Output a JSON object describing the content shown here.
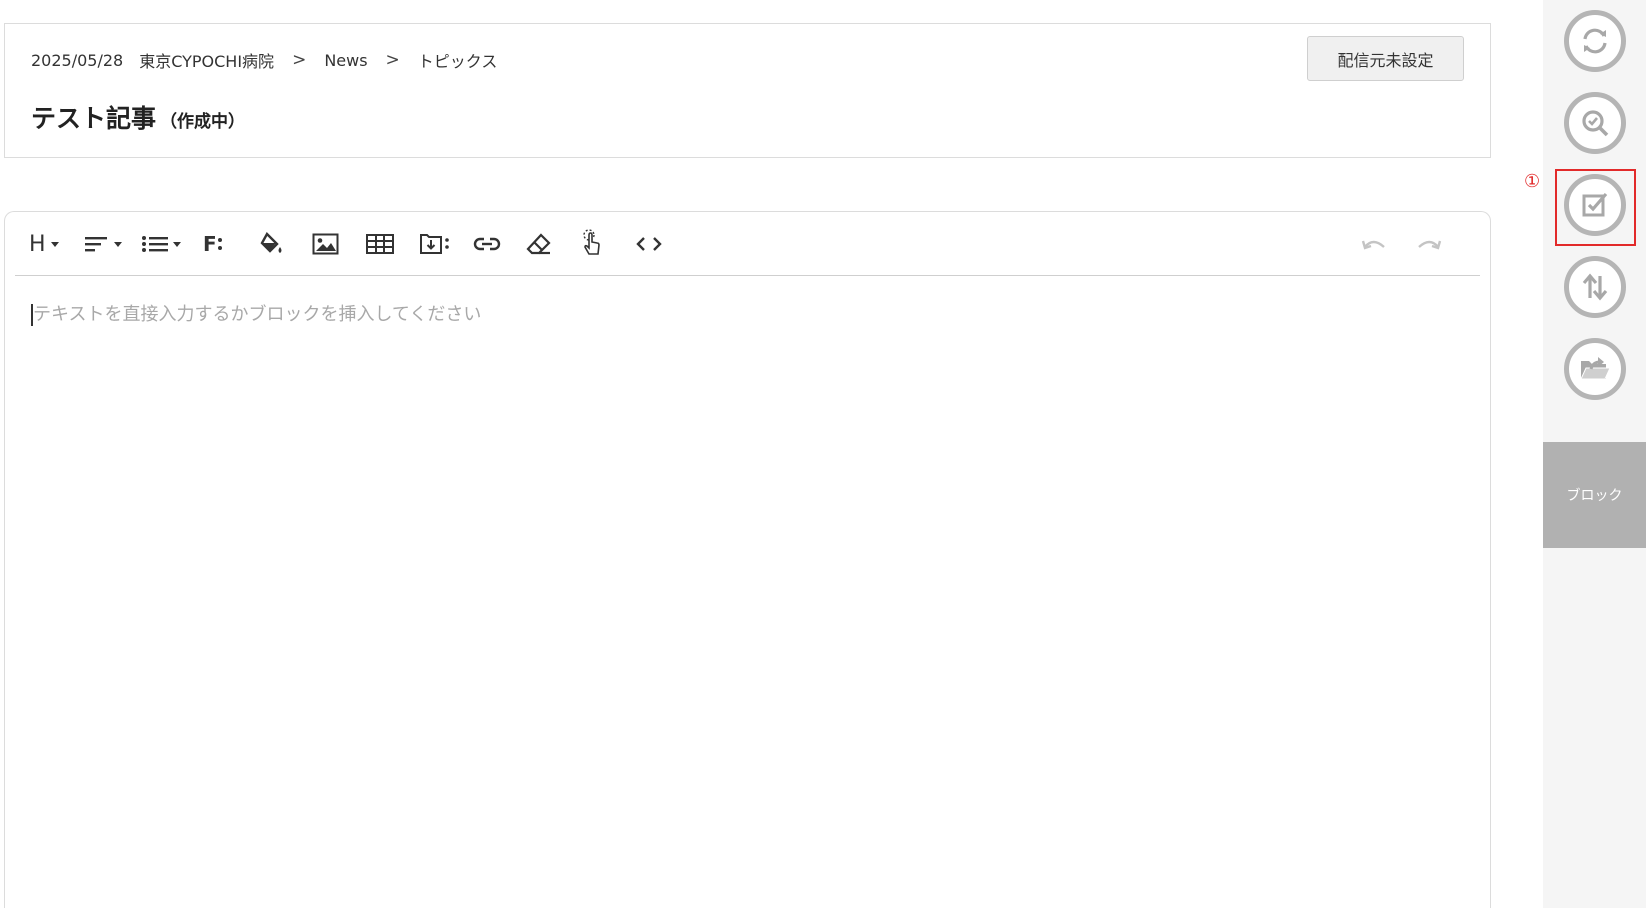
{
  "header": {
    "date": "2025/05/28",
    "breadcrumb": [
      "東京CYPOCHI病院",
      "News",
      "トピックス"
    ],
    "separator": ">",
    "title": "テスト記事",
    "status": "（作成中）",
    "source_button_label": "配信元未設定"
  },
  "toolbar": {
    "heading_label": "H",
    "format_label": "F",
    "tools": [
      "heading-icon",
      "text-align-icon",
      "list-icon",
      "font-format-icon",
      "fill-color-icon",
      "image-icon",
      "table-icon",
      "download-box-icon",
      "link-icon",
      "eraser-icon",
      "pointer-hand-icon",
      "code-icon",
      "undo-icon",
      "redo-icon"
    ]
  },
  "editor": {
    "placeholder": "テキストを直接入力するかブロックを挿入してください"
  },
  "sidebar": {
    "buttons": [
      "sync-icon",
      "search-check-icon",
      "checkbox-icon",
      "sort-arrows-icon",
      "folder-upload-icon"
    ],
    "callout_number": "①",
    "block_tab_label": "ブロック"
  },
  "colors": {
    "highlight": "#e22a2a",
    "sidebar_bg": "#f5f5f5",
    "block_tab_bg": "#b1b1b1",
    "icon_gray": "#b5b5b5"
  }
}
